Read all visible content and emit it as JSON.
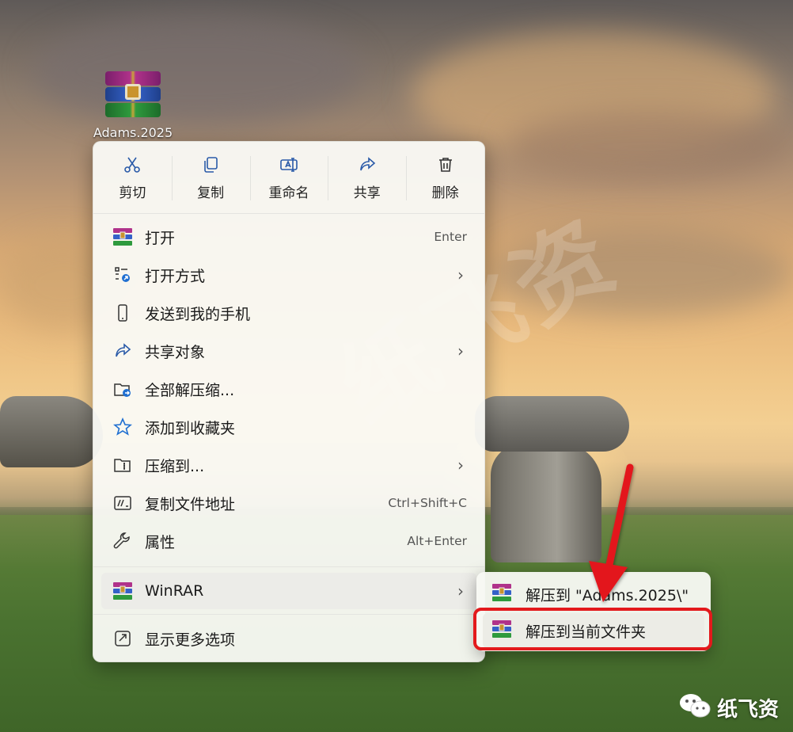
{
  "desktop": {
    "icon_label": "Adams.2025",
    "icon": "winrar-archive-icon"
  },
  "quick_actions": [
    {
      "label": "剪切",
      "icon": "scissors-icon"
    },
    {
      "label": "复制",
      "icon": "copy-icon"
    },
    {
      "label": "重命名",
      "icon": "rename-icon"
    },
    {
      "label": "共享",
      "icon": "share-icon"
    },
    {
      "label": "删除",
      "icon": "trash-icon"
    }
  ],
  "menu_items": [
    {
      "label": "打开",
      "shortcut": "Enter",
      "icon": "winrar-icon"
    },
    {
      "label": "打开方式",
      "shortcut": "",
      "icon": "open-with-icon",
      "submenu": true
    },
    {
      "label": "发送到我的手机",
      "shortcut": "",
      "icon": "phone-icon"
    },
    {
      "label": "共享对象",
      "shortcut": "",
      "icon": "share-icon",
      "submenu": true
    },
    {
      "label": "全部解压缩...",
      "shortcut": "",
      "icon": "extract-folder-icon"
    },
    {
      "label": "添加到收藏夹",
      "shortcut": "",
      "icon": "star-icon"
    },
    {
      "label": "压缩到...",
      "shortcut": "",
      "icon": "zip-folder-icon",
      "submenu": true
    },
    {
      "label": "复制文件地址",
      "shortcut": "Ctrl+Shift+C",
      "icon": "copy-path-icon"
    },
    {
      "label": "属性",
      "shortcut": "Alt+Enter",
      "icon": "wrench-icon"
    },
    {
      "label": "WinRAR",
      "shortcut": "",
      "icon": "winrar-icon",
      "submenu": true
    },
    {
      "label": "显示更多选项",
      "shortcut": "",
      "icon": "more-options-icon"
    }
  ],
  "submenu_items": [
    {
      "label": "解压到 \"Adams.2025\\\"",
      "icon": "winrar-icon"
    },
    {
      "label": "解压到当前文件夹",
      "icon": "winrar-icon"
    }
  ],
  "watermark": {
    "text": "纸飞资"
  },
  "colors": {
    "highlight_box": "#e3191c",
    "arrow": "#e3191c"
  }
}
